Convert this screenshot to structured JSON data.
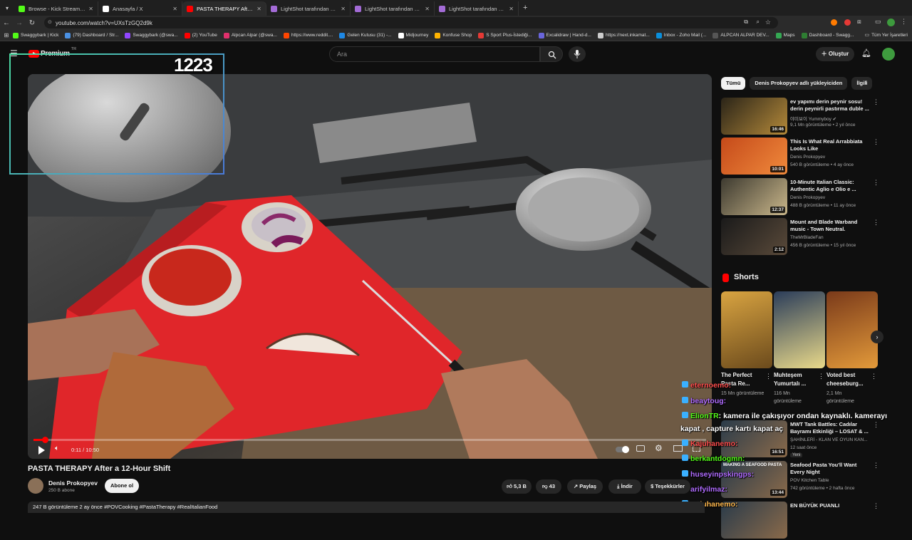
{
  "browser": {
    "tabs": [
      {
        "title": "Browse - Kick Streaming",
        "color": "#53fc18",
        "active": false
      },
      {
        "title": "Anasayfa / X",
        "color": "#ffffff",
        "active": false
      },
      {
        "title": "PASTA THERAPY After a 12…",
        "color": "#ff0000",
        "active": true
      },
      {
        "title": "LightShot tarafından Ekran Gör…",
        "color": "#a36bd6",
        "active": false
      },
      {
        "title": "LightShot tarafından Ekran Gör…",
        "color": "#a36bd6",
        "active": false
      },
      {
        "title": "LightShot tarafından Ekran Gör…",
        "color": "#a36bd6",
        "active": false
      }
    ],
    "new_tab": "+",
    "url": "youtube.com/watch?v=UXsTzGQ2d9k",
    "bookmarks": [
      "Swaggybark | Kick",
      "(79) Dashboard / Str...",
      "Swaggybark (@swa...",
      "(2) YouTube",
      "Alpcan Alpar (@swa...",
      "https://www.reddit....",
      "Gelen Kutusu (31) -...",
      "Midjourney",
      "Konfuse Shop",
      "S Sport Plus-İstediği...",
      "Excalidraw | Hand-d...",
      "https://next.inkamat...",
      "Inbox - Zoho Mail (...",
      "ALPCAN ALPAR DEV...",
      "Maps",
      "Dashboard - Swagg..."
    ],
    "all_bookmarks": "Tüm Yer İşaretleri"
  },
  "yt": {
    "logo": "Premium",
    "region": "TR",
    "search_placeholder": "Ara",
    "create": "Oluştur"
  },
  "overlay": {
    "counter": "1223"
  },
  "player": {
    "time": "0:11 / 10:50",
    "progress": 0.017
  },
  "video": {
    "title": "PASTA THERAPY After a 12-Hour Shift",
    "channel": "Denis Prokopyev",
    "subs": "250 B abone",
    "subscribe": "Abone ol",
    "likes": "5,3 B",
    "dislikes": "43",
    "share": "Paylaş",
    "download": "İndir",
    "thanks": "Teşekkürler",
    "desc": "247 B görüntüleme  2 ay önce  #POVCooking #PastaTherapy #RealItalianFood"
  },
  "chips": [
    "Tümü",
    "Denis Prokopyev adlı yükleyiciden",
    "İlgili"
  ],
  "recs": [
    {
      "title": "ev yapımı derin peynir sosu! derin peynirli pastırma duble ...",
      "channel": "야미보이 Yummyboy ✔",
      "meta": "9,1 Mn görüntüleme • 2 yıl önce",
      "dur": "16:46",
      "c1": "#2a2418",
      "c2": "#b58a3a"
    },
    {
      "title": "This Is What Real Arrabbiata Looks Like",
      "channel": "Denis Prokopyev",
      "meta": "540 B görüntüleme • 4 ay önce",
      "dur": "10:01",
      "c1": "#c54a1a",
      "c2": "#f08a3c"
    },
    {
      "title": "10-Minute Italian Classic: Authentic Aglio e Olio e ...",
      "channel": "Denis Prokopyev",
      "meta": "488 B görüntüleme • 11 ay önce",
      "dur": "12:37",
      "c1": "#3d3a30",
      "c2": "#c9b68a"
    },
    {
      "title": "Mount and Blade Warband music - Town Neutral.",
      "channel": "TheMrBladeFan",
      "meta": "456 B görüntüleme • 15 yıl önce",
      "dur": "2:12",
      "c1": "#1a1a1a",
      "c2": "#5a4a3a"
    }
  ],
  "shorts": {
    "heading": "Shorts",
    "items": [
      {
        "title": "The Perfect Pasta Re...",
        "views": "15 Mn görüntüleme",
        "c1": "#d9a441",
        "c2": "#6b4a1c"
      },
      {
        "title": "Muhteşem Yumurtalı ...",
        "views": "116 Mn görüntüleme",
        "c1": "#2b3d5a",
        "c2": "#e9d98a"
      },
      {
        "title": "Voted best cheeseburg...",
        "views": "2,1 Mn görüntüleme",
        "c1": "#7a3a1a",
        "c2": "#e39a3a"
      }
    ]
  },
  "recs2": [
    {
      "title": "MWT Tank Battles: Cadılar Bayramı Etkinliği – LOSAT & ...",
      "channel": "ŞAHİNLERİ - KLAN VE OYUN KAN...",
      "meta": "12 saat önce",
      "badge": "Yeni",
      "dur": "16:51"
    },
    {
      "title": "Seafood Pasta You'll Want Every Night",
      "channel": "POV Kitchen Table",
      "meta": "742 görüntüleme • 2 hafta önce",
      "dur": "13:44",
      "thumb_text": "MAKING A SEAFOOD PASTA"
    },
    {
      "title": "EN BÜYÜK PUANLI",
      "channel": "",
      "meta": "",
      "dur": ""
    }
  ],
  "chat": [
    {
      "user": "eternoemo:",
      "text": "",
      "color": "#ff4d4d"
    },
    {
      "user": "beaytoug:",
      "text": "",
      "color": "#b06cff"
    },
    {
      "user": "ElionTR",
      "text": ": kamera ile çakışıyor ondan kaynaklı. kamerayı",
      "color": "#53fc18"
    },
    {
      "user": "",
      "text": "kapat , capture kartı kapat aç",
      "color": "#ffffff"
    },
    {
      "user": "Kajuhanemo:",
      "text": "",
      "color": "#ff4d4d"
    },
    {
      "user": "berkantdogmn:",
      "text": "",
      "color": "#53fc18"
    },
    {
      "user": "huseyinpskingps:",
      "text": "",
      "color": "#b06cff"
    },
    {
      "user": "arifyilmaz:",
      "text": "",
      "color": "#b06cff"
    },
    {
      "user": "Kajuhanemo:",
      "text": "",
      "color": "#ffb84d"
    }
  ]
}
